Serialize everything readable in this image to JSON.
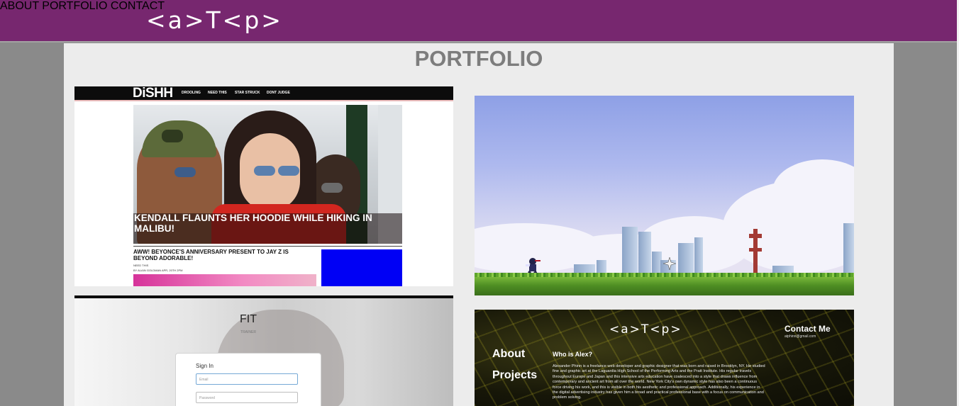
{
  "header": {
    "logo_text": "<a>T<p>",
    "nav": [
      {
        "label": "ABOUT"
      },
      {
        "label": "PORTFOLIO"
      },
      {
        "label": "CONTACT"
      }
    ]
  },
  "colors": {
    "brand_purple": "#77276f",
    "nav_text": "#a7a7a7",
    "title_gray": "#7d7d7d",
    "panel_bg": "#ececec"
  },
  "main": {
    "title": "PORTFOLIO",
    "projects": {
      "dishh": {
        "logo": "DiSHH",
        "nav": [
          "DROOLING",
          "NEED THIS",
          "STAR STRUCK",
          "DONT JUDGE"
        ],
        "headline": "KENDALL FLAUNTS HER HOODIE WHILE HIKING IN MALIBU!",
        "subheadline": "AWW! BEYONCE'S ANNIVERSARY PRESENT TO JAY Z IS BEYOND ADORABLE!",
        "meta_tag": "NEED THIS",
        "byline": "BY ALAIN GOLDMAN  APR, 20TH 2PM"
      },
      "game": {
        "icon": "side-scroller-game-screenshot"
      },
      "fit": {
        "title": "FIT",
        "tagline": "TRAINER",
        "signin_label": "Sign In",
        "email_placeholder": "Email",
        "password_placeholder": "Password"
      },
      "about": {
        "logo_text": "<a>T<p>",
        "contact_heading": "Contact Me",
        "contact_email": "atphinn@gmail.com",
        "links": [
          "About",
          "Projects"
        ],
        "who_heading": "Who is Alex?",
        "bio": "Alexander Phinn is a freelance web developer and graphic designer that was born and raised in Brooklyn, NY. He studied fine and graphic art at the Laguardia High School of the Performing Arts and the Pratt Institute. His regular travels throughout Europe and Japan and this intensive arts education have coalesced into a style that draws influence from contemporary and ancient art from all over the world. New York City's own dynamic style has also been a continuous force driving his work, and this is visible in both his aesthetic and professional approach. Additionally, his experience in the digital advertising industry has given him a broad and practical professional base with a focus on communication and problem solving."
      }
    }
  }
}
